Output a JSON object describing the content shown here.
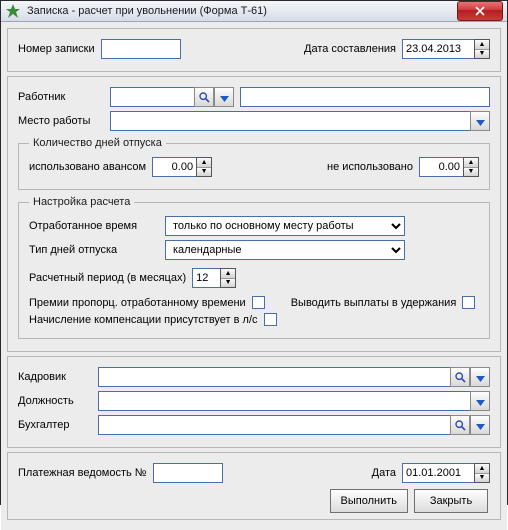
{
  "window": {
    "title": "Записка - расчет при увольнении (Форма Т-61)"
  },
  "top": {
    "note_number_label": "Номер записки",
    "note_number_value": "",
    "date_label": "Дата составления",
    "date_value": "23.04.2013"
  },
  "employee": {
    "worker_label": "Работник",
    "worker_value": "",
    "worker_extra": "",
    "place_label": "Место работы",
    "place_value": ""
  },
  "vacation_days": {
    "legend": "Количество дней отпуска",
    "used_advance_label": "использовано авансом",
    "used_advance_value": "0.00",
    "not_used_label": "не использовано",
    "not_used_value": "0.00"
  },
  "calc_settings": {
    "legend": "Настройка расчета",
    "worked_time_label": "Отработанное время",
    "worked_time_value": "только по основному месту работы",
    "day_type_label": "Тип дней отпуска",
    "day_type_value": "календарные",
    "period_label": "Расчетный период (в месяцах)",
    "period_value": "12",
    "bonus_prop_label": "Премии пропорц. отработанному времени",
    "output_to_ded_label": "Выводить выплаты в удержания",
    "comp_in_ls_label": "Начисление компенсации присутствует в л/с"
  },
  "signers": {
    "hr_label": "Кадровик",
    "hr_value": "",
    "position_label": "Должность",
    "position_value": "",
    "accountant_label": "Бухгалтер",
    "accountant_value": ""
  },
  "footer": {
    "payroll_label": "Платежная ведомость №",
    "payroll_value": "",
    "date_label": "Дата",
    "date_value": "01.01.2001",
    "execute": "Выполнить",
    "close": "Закрыть"
  }
}
